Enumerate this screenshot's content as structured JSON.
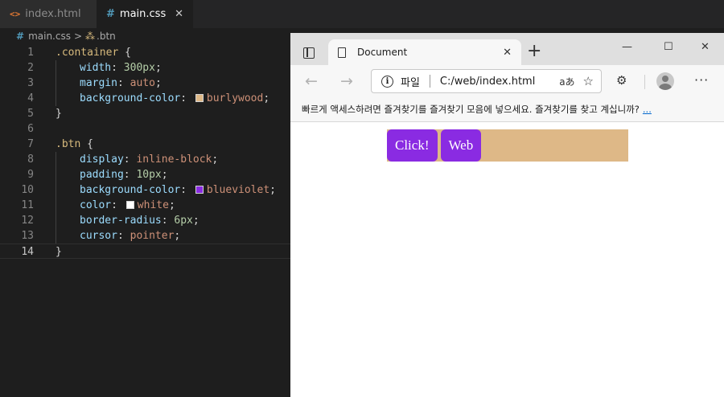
{
  "editor": {
    "tabs": [
      {
        "icon": "<>",
        "label": "index.html"
      },
      {
        "icon": "#",
        "label": "main.css",
        "close": "✕"
      }
    ],
    "breadcrumb": {
      "file": "main.css",
      "separator": ">",
      "selector": ".btn"
    },
    "lines": {
      "n1": "1",
      "n2": "2",
      "n3": "3",
      "n4": "4",
      "n5": "5",
      "n6": "6",
      "n7": "7",
      "n8": "8",
      "n9": "9",
      "n10": "10",
      "n11": "11",
      "n12": "12",
      "n13": "13",
      "n14": "14",
      "l1_sel": ".container",
      "l1_brace": " {",
      "l2_prop": "width",
      "l2_val": "300px",
      "l3_prop": "margin",
      "l3_val": "auto",
      "l4_prop": "background-color",
      "l4_val": "burlywood",
      "l5": "}",
      "l7_sel": ".btn",
      "l7_brace": " {",
      "l8_prop": "display",
      "l8_val": "inline-block",
      "l9_prop": "padding",
      "l9_val": "10px",
      "l10_prop": "background-color",
      "l10_val": "blueviolet",
      "l11_prop": "color",
      "l11_val": "white",
      "l12_prop": "border-radius",
      "l12_val": "6px",
      "l13_prop": "cursor",
      "l13_val": "pointer",
      "l14": "}"
    },
    "swatches": {
      "burlywood": "#deb887",
      "blueviolet": "#8a2be2",
      "white": "#ffffff"
    }
  },
  "browser": {
    "tab_title": "Document",
    "tab_close": "✕",
    "new_tab": "+",
    "window": {
      "minimize": "—",
      "maximize": "☐",
      "close": "✕"
    },
    "nav": {
      "back": "←",
      "forward": "→"
    },
    "address": {
      "info": "i",
      "protocol_label": "파일",
      "url": "C:/web/index.html",
      "read_aloud": "aあ",
      "favorite": "☆"
    },
    "extensions": "⚙",
    "more": "···",
    "favorites_bar": {
      "message": "빠르게 액세스하려면 즐겨찾기를 즐겨찾기 모음에 넣으세요. 즐겨찾기를 찾고 계십니까?",
      "link": "..."
    },
    "page": {
      "buttons": [
        "Click!",
        "Web"
      ]
    }
  }
}
